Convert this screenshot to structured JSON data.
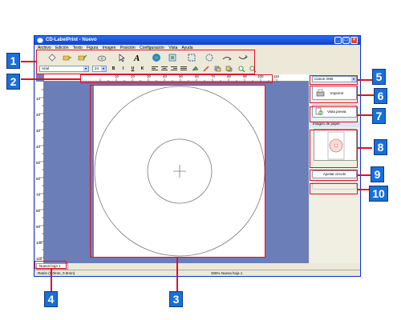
{
  "window": {
    "title": "CD-LabelPrint - Nuevo",
    "controls": [
      "_",
      "□",
      "×"
    ]
  },
  "menubar": {
    "items": [
      "Archivo",
      "Edición",
      "Texto",
      "Figura",
      "Imagen",
      "Posición",
      "Configuración",
      "Vista",
      "Ayuda"
    ]
  },
  "toolbar2": {
    "font": "Arial",
    "size": "24",
    "buttons": [
      "B",
      "I",
      "U",
      "K"
    ]
  },
  "panel": {
    "printer": "Canon iX65",
    "print_label": "Imprimir",
    "preview_label": "Vista previa",
    "paper_section": "Imagen de papel",
    "adjust_label": "Ajustar circulo"
  },
  "ruler": {
    "h_ticks": [
      "10",
      "20",
      "30",
      "40",
      "50",
      "60",
      "70",
      "80",
      "90",
      "100",
      "110"
    ],
    "v_ticks": [
      "10",
      "20",
      "30",
      "40",
      "50",
      "60",
      "70",
      "80",
      "90",
      "100",
      "110"
    ]
  },
  "sheet_tab": "Nueva hoja 1",
  "status": {
    "left": "Ratón (0.0mm, 0.0mm)",
    "right": "326%  Nueva hoja 1"
  },
  "callouts": [
    "1",
    "2",
    "3",
    "4",
    "5",
    "6",
    "7",
    "8",
    "9",
    "10"
  ],
  "colors": {
    "callout": "#1a6fd8",
    "highlight": "#e0102a",
    "workspace": "#6c7eb7",
    "titlebar": "#0a44c8"
  }
}
